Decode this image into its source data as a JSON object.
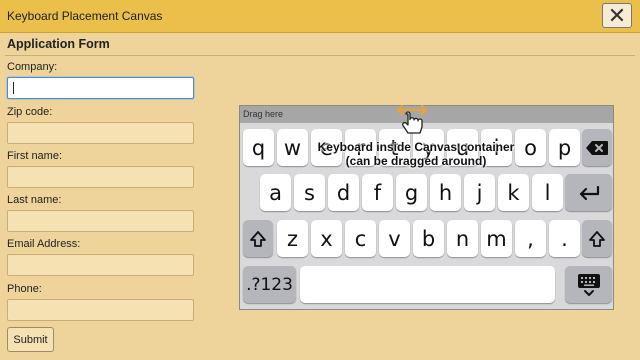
{
  "window": {
    "title": "Keyboard Placement Canvas",
    "close_glyph": "✕"
  },
  "form": {
    "heading": "Application Form",
    "fields": [
      {
        "label": "Company:",
        "value": ""
      },
      {
        "label": "Zip code:",
        "value": ""
      },
      {
        "label": "First name:",
        "value": ""
      },
      {
        "label": "Last name:",
        "value": ""
      },
      {
        "label": "Email Address:",
        "value": ""
      },
      {
        "label": "Phone:",
        "value": ""
      }
    ],
    "submit_label": "Submit"
  },
  "keyboard": {
    "drag_label": "Drag here",
    "overlay_line1": "Keyboard inside Canvas container",
    "overlay_line2": "(can be dragged around)",
    "row1": [
      "q",
      "w",
      "e",
      "r",
      "t",
      "y",
      "u",
      "i",
      "o",
      "p"
    ],
    "row2": [
      "a",
      "s",
      "d",
      "f",
      "g",
      "h",
      "j",
      "k",
      "l"
    ],
    "row3": [
      "z",
      "x",
      "c",
      "v",
      "b",
      "n",
      "m",
      ",",
      "."
    ],
    "numbers_label": ".?123",
    "icons": {
      "backspace": "backspace-icon",
      "enter": "enter-icon",
      "shift": "shift-icon",
      "hide_keyboard": "keyboard-hide-icon",
      "move_cursor": "move-cursor-icon"
    },
    "colors": {
      "key": "#ffffff",
      "function_key": "#b4b6bc",
      "background": "#d9d9dc"
    }
  },
  "colors": {
    "titlebar": "#eabf4a",
    "page": "#eed49a",
    "input": "#f6e1b2",
    "focus_border": "#5e8ba8"
  }
}
